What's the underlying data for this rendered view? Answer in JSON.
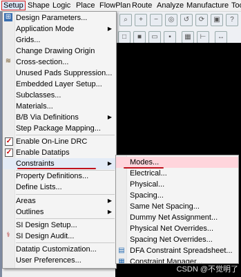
{
  "menubar": {
    "items": [
      {
        "label": "Setup"
      },
      {
        "label": "Shape"
      },
      {
        "label": "Logic"
      },
      {
        "label": "Place"
      },
      {
        "label": "FlowPlan"
      },
      {
        "label": "Route"
      },
      {
        "label": "Analyze"
      },
      {
        "label": "Manufacture"
      },
      {
        "label": "Too"
      }
    ]
  },
  "setup_menu": {
    "items": [
      {
        "label": "Design Parameters...",
        "icon": "design-parameters-icon"
      },
      {
        "label": "Application Mode",
        "submenu": true
      },
      {
        "label": "Grids..."
      },
      {
        "label": "Change Drawing Origin"
      },
      {
        "label": "Cross-section...",
        "icon": "cross-section-icon"
      },
      {
        "label": "Unused Pads Suppression..."
      },
      {
        "label": "Embedded Layer Setup..."
      },
      {
        "label": "Subclasses..."
      },
      {
        "label": "Materials..."
      },
      {
        "label": "B/B Via Definitions",
        "submenu": true
      },
      {
        "label": "Step Package Mapping..."
      },
      {
        "label": "Enable On-Line DRC",
        "checked": true
      },
      {
        "label": "Enable Datatips",
        "checked": true
      },
      {
        "label": "Constraints",
        "submenu": true,
        "highlighted": true
      },
      {
        "label": "Property Definitions..."
      },
      {
        "label": "Define Lists..."
      },
      {
        "label": "Areas",
        "submenu": true
      },
      {
        "label": "Outlines",
        "submenu": true
      },
      {
        "label": "SI Design Setup..."
      },
      {
        "label": "SI Design Audit...",
        "icon": "si-audit-icon"
      },
      {
        "label": "Datatip Customization..."
      },
      {
        "label": "User Preferences..."
      }
    ]
  },
  "constraints_submenu": {
    "items": [
      {
        "label": "Modes...",
        "highlighted": true
      },
      {
        "label": "Electrical..."
      },
      {
        "label": "Physical..."
      },
      {
        "label": "Spacing..."
      },
      {
        "label": "Same Net Spacing..."
      },
      {
        "label": "Dummy Net Assignment..."
      },
      {
        "label": "Physical Net Overrides..."
      },
      {
        "label": "Spacing Net Overrides..."
      },
      {
        "label": "DFA Constraint Spreadsheet...",
        "icon": "dfa-spreadsheet-icon"
      },
      {
        "label": "Constraint Manager...",
        "icon": "constraint-manager-icon"
      }
    ]
  },
  "watermark": "CSDN @不觉明了",
  "colors": {
    "highlight": "#e3ebf6",
    "submenu_highlight": "#ffd5dc",
    "annotation_red": "#c0121d"
  }
}
